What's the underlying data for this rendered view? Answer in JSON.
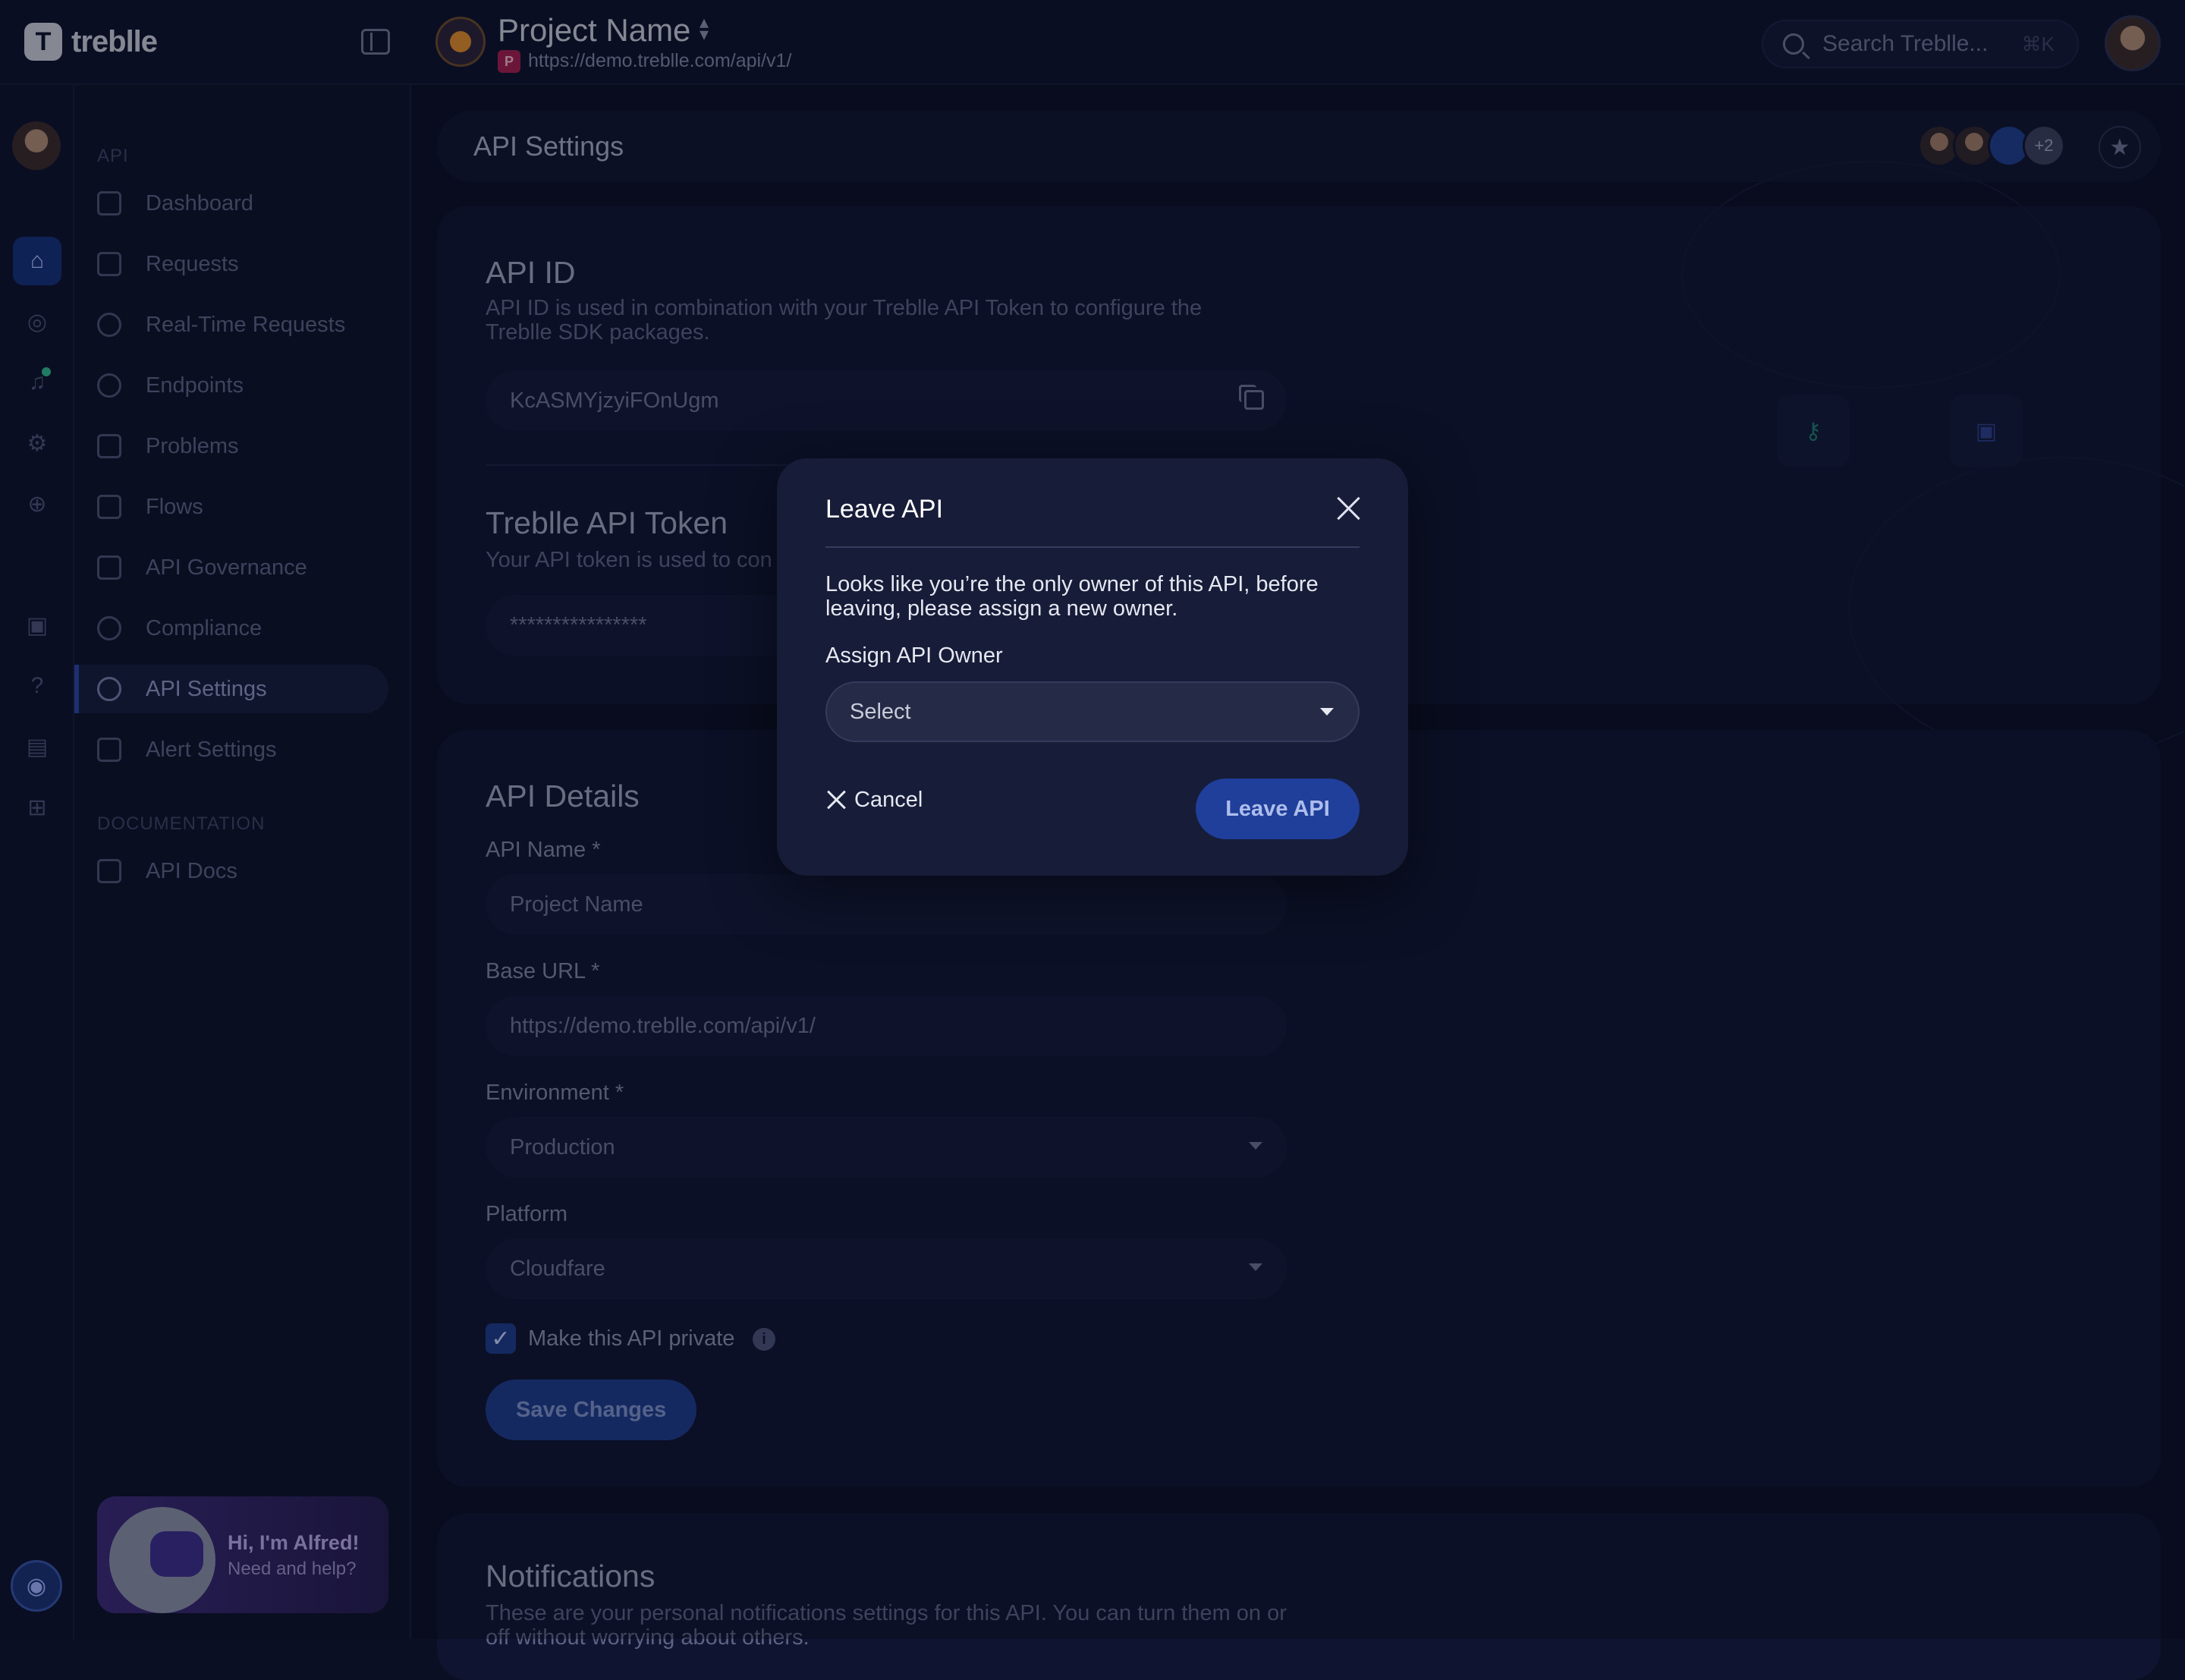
{
  "app": {
    "logo_text": "treblle",
    "logo_mark": "T"
  },
  "topbar": {
    "project_name": "Project Name",
    "project_url": "https://demo.treblle.com/api/v1/",
    "project_badge": "P",
    "search_placeholder": "Search Treblle...",
    "search_shortcut": "⌘K"
  },
  "sidebar": {
    "section_api": "API",
    "items": [
      {
        "label": "Dashboard",
        "icon": "grid-icon"
      },
      {
        "label": "Requests",
        "icon": "arrows-icon"
      },
      {
        "label": "Real-Time Requests",
        "icon": "realtime-icon"
      },
      {
        "label": "Endpoints",
        "icon": "endpoints-icon"
      },
      {
        "label": "Problems",
        "icon": "problems-icon"
      },
      {
        "label": "Flows",
        "icon": "flows-icon"
      },
      {
        "label": "API Governance",
        "icon": "governance-icon"
      },
      {
        "label": "Compliance",
        "icon": "compliance-icon"
      },
      {
        "label": "API Settings",
        "icon": "gear-icon",
        "active": true
      },
      {
        "label": "Alert Settings",
        "icon": "warning-icon"
      }
    ],
    "section_docs": "DOCUMENTATION",
    "docs_items": [
      {
        "label": "API Docs",
        "icon": "docs-icon"
      }
    ],
    "alfred_title": "Hi, I'm Alfred!",
    "alfred_sub": "Need and help?"
  },
  "header": {
    "title": "API Settings",
    "collaborators_more": "+2",
    "star_icon": "★"
  },
  "api_id": {
    "title": "API ID",
    "description": "API ID is used in combination with your Treblle API Token to configure the Treblle SDK packages.",
    "value": "KcASMYjzyiFOnUgm"
  },
  "api_token": {
    "title": "Treblle API Token",
    "description": "Your API token is used to con",
    "value": "****************"
  },
  "api_details": {
    "title": "API Details",
    "name_label": "API Name *",
    "name_value": "Project Name",
    "url_label": "Base URL *",
    "url_value": "https://demo.treblle.com/api/v1/",
    "env_label": "Environment *",
    "env_value": "Production",
    "platform_label": "Platform",
    "platform_value": "Cloudfare",
    "private_label": "Make this API private",
    "private_checked": true,
    "info_glyph": "i",
    "check_glyph": "✓",
    "save_label": "Save Changes"
  },
  "notifications": {
    "title": "Notifications",
    "description": "These are your personal notifications settings for this API. You can turn them on or off without worrying about others."
  },
  "modal": {
    "title": "Leave API",
    "description": "Looks like you’re the only owner of this API, before leaving, please assign a new owner.",
    "assign_label": "Assign API Owner",
    "select_value": "Select",
    "cancel_label": "Cancel",
    "leave_label": "Leave API"
  },
  "colors": {
    "accent": "#1f3f9a",
    "background": "#0b0f24",
    "modal_bg": "#171c38"
  }
}
